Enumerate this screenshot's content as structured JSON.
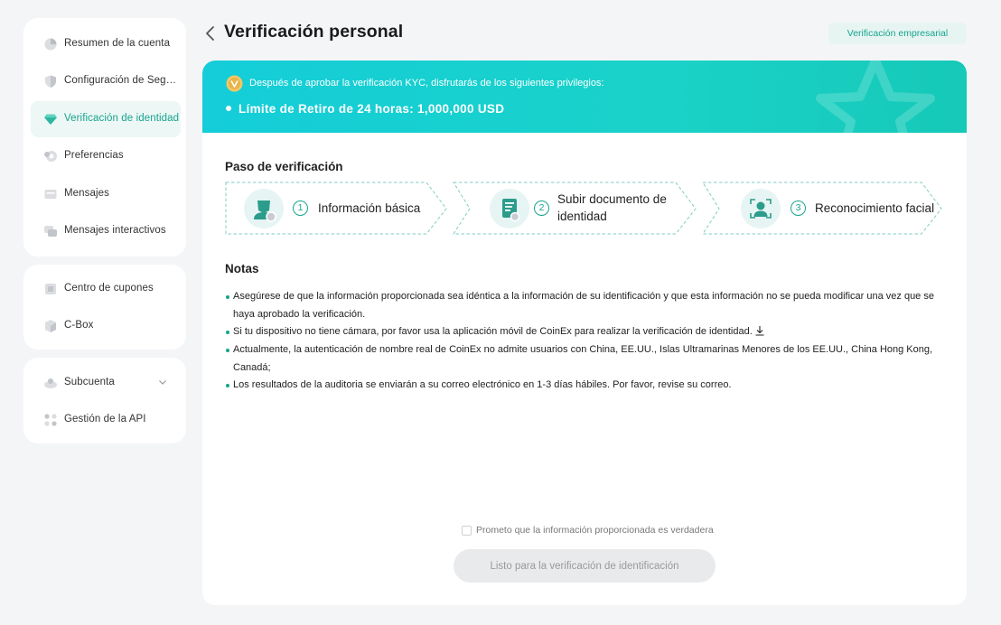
{
  "sidebar": {
    "group1": [
      {
        "label": "Resumen de la cuenta",
        "icon": "pie-chart-icon"
      },
      {
        "label": "Configuración de Seguridad",
        "icon": "shield-icon"
      },
      {
        "label": "Verificación de identidad",
        "icon": "diamond-icon",
        "active": true
      },
      {
        "label": "Preferencias",
        "icon": "settings-icon"
      },
      {
        "label": "Mensajes",
        "icon": "mail-icon"
      },
      {
        "label": "Mensajes interactivos",
        "icon": "chat-icon"
      }
    ],
    "group2": [
      {
        "label": "Centro de cupones",
        "icon": "coupon-icon"
      },
      {
        "label": "C-Box",
        "icon": "box-icon"
      }
    ],
    "group3": [
      {
        "label": "Subcuenta",
        "icon": "subaccount-icon"
      },
      {
        "label": "Gestión de la API",
        "icon": "api-icon"
      }
    ]
  },
  "header": {
    "title": "Verificación personal",
    "business_button": "Verificación empresarial"
  },
  "banner": {
    "intro": "Después de aprobar la verificación KYC, disfrutarás de los siguientes privilegios:",
    "privilege": "Límite de Retiro de 24 horas: 1,000,000 USD"
  },
  "steps": {
    "title": "Paso de verificación",
    "items": [
      {
        "number": "1",
        "line1": "Información básica",
        "line2": ""
      },
      {
        "number": "2",
        "line1": "Subir documento de",
        "line2": "identidad"
      },
      {
        "number": "3",
        "line1": "Reconocimiento facial",
        "line2": ""
      }
    ]
  },
  "notes": {
    "title": "Notas",
    "items": [
      "Asegúrese de que la información proporcionada sea idéntica a la información de su identificación y que esta información no se pueda modificar una vez que se haya aprobado la verificación.",
      "Si tu dispositivo no tiene cámara, por favor usa la aplicación móvil de CoinEx para realizar la verificación de identidad.",
      "Actualmente, la autenticación de nombre real de CoinEx no admite usuarios con China, EE.UU., Islas Ultramarinas Menores de los EE.UU., China Hong Kong, Canadá;",
      "Los resultados de la auditoria se enviarán a su correo electrónico en 1-3 días hábiles. Por favor, revise su correo."
    ]
  },
  "footer": {
    "promise": "Prometo que la información proporcionada es verdadera",
    "submit": "Listo para la verificación de identificación"
  },
  "colors": {
    "accent": "#17a48e",
    "banner_start": "#14cdd9",
    "banner_end": "#16c9b8",
    "background": "#f4f5f7"
  }
}
